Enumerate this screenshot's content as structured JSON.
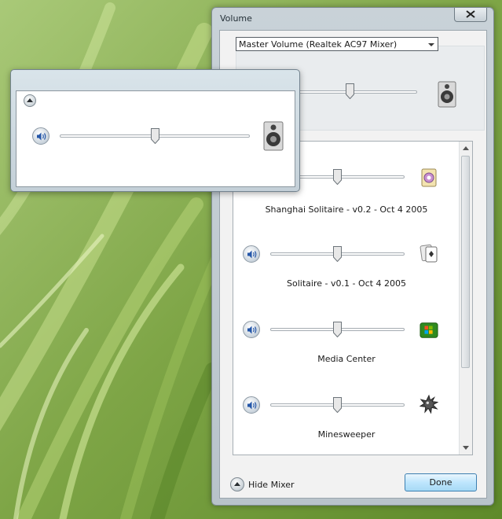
{
  "window": {
    "title": "Volume"
  },
  "device_select": {
    "value": "Master Volume (Realtek AC97 Mixer)"
  },
  "master": {
    "volume": 0.5
  },
  "apps": [
    {
      "name": "Shanghai Solitaire - v0.2 - Oct  4 2005",
      "icon": "shanghai-solitaire-icon",
      "volume": 0.5
    },
    {
      "name": "Solitaire - v0.1 - Oct  4 2005",
      "icon": "solitaire-icon",
      "volume": 0.5
    },
    {
      "name": "Media Center",
      "icon": "media-center-icon",
      "volume": 0.5
    },
    {
      "name": "Minesweeper",
      "icon": "minesweeper-icon",
      "volume": 0.5
    }
  ],
  "footer": {
    "hide_mixer_label": "Hide Mixer",
    "done_label": "Done"
  },
  "popup": {
    "volume": 0.5
  }
}
